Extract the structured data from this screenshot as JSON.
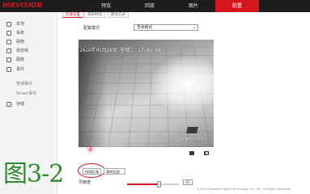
{
  "app": {
    "logo": "HIKVISION"
  },
  "nav": {
    "items": [
      {
        "label": "预览",
        "active": false
      },
      {
        "label": "回放",
        "active": false
      },
      {
        "label": "图片",
        "active": false
      },
      {
        "label": "配置",
        "active": true
      }
    ]
  },
  "sidebar": {
    "items": [
      {
        "label": "本地",
        "icon": "monitor-icon"
      },
      {
        "label": "系统",
        "icon": "system-icon"
      },
      {
        "label": "网络",
        "icon": "network-icon"
      },
      {
        "label": "视音频",
        "icon": "video-audio-icon"
      },
      {
        "label": "图像",
        "icon": "image-icon"
      },
      {
        "label": "事件",
        "icon": "event-icon"
      },
      {
        "label": "普通事件",
        "active": true
      },
      {
        "label": "Smart事件"
      },
      {
        "label": "存储",
        "icon": "storage-icon"
      }
    ]
  },
  "tabs": [
    {
      "label": "区域设置",
      "active": true
    },
    {
      "label": "布防时间",
      "active": false
    },
    {
      "label": "联动方式",
      "active": false
    }
  ],
  "config": {
    "mode_label": "配置模式",
    "mode_value": "普通模式"
  },
  "video": {
    "osd_time": "2020年05月26日 星期二 17:43:04",
    "osd_camera": "Camera 01"
  },
  "annotation": {
    "step_marker": "④",
    "figure_label": "图3-2"
  },
  "controls": {
    "draw_area": "绘制区域",
    "clear_all": "清除全部",
    "sensitivity_label": "灵敏度",
    "sensitivity_value": "61",
    "sensitivity_fraction": 0.61
  },
  "footer": {
    "copyright": "©2018 Hikvision Digital Technology Co., Ltd. All Rights Reserved."
  },
  "colors": {
    "accent": "#d6161f",
    "topbar": "#1d1d1d",
    "figure_label": "#2e8b2e"
  }
}
